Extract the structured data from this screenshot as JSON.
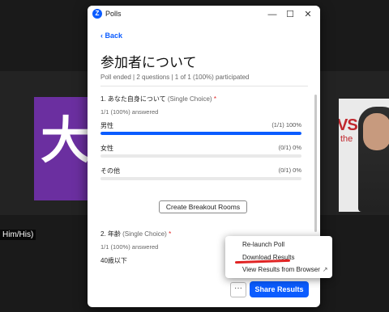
{
  "background": {
    "left_tile_glyph": "大",
    "right_tile_brand": "VS",
    "right_tile_brand_sub": "the",
    "name_tag": "Him/His)"
  },
  "window": {
    "app_title": "Polls",
    "app_icon_letter": "Z",
    "minimize_icon": "—",
    "maximize_icon": "☐",
    "close_icon": "✕"
  },
  "poll": {
    "back_label": "Back",
    "title": "参加者について",
    "meta": "Poll ended  |  2 questions  |  1 of 1 (100%) participated"
  },
  "questions": [
    {
      "number_title": "1. あなた自身について",
      "kind": "(Single Choice)",
      "required_mark": "*",
      "answered": "1/1 (100%) answered",
      "options": [
        {
          "label": "男性",
          "value": "(1/1) 100%",
          "fraction": 1.0,
          "highlight": true
        },
        {
          "label": "女性",
          "value": "(0/1) 0%",
          "fraction": 0.0,
          "highlight": false
        },
        {
          "label": "その他",
          "value": "(0/1) 0%",
          "fraction": 0.0,
          "highlight": false
        }
      ]
    },
    {
      "number_title": "2. 年齢",
      "kind": "(Single Choice)",
      "required_mark": "*",
      "answered": "1/1 (100%) answered",
      "options": [
        {
          "label": "40歳以下",
          "value": "",
          "fraction": 0.0,
          "highlight": false
        }
      ]
    }
  ],
  "buttons": {
    "breakout": "Create Breakout Rooms",
    "more": "···",
    "share": "Share Results"
  },
  "menu": {
    "items": [
      "Re-launch Poll",
      "Download Results",
      "View Results from Browser"
    ],
    "external_icon": "↗"
  },
  "colors": {
    "accent": "#0b5cff",
    "required": "#e02424",
    "annotation_underline": "#e02424"
  }
}
